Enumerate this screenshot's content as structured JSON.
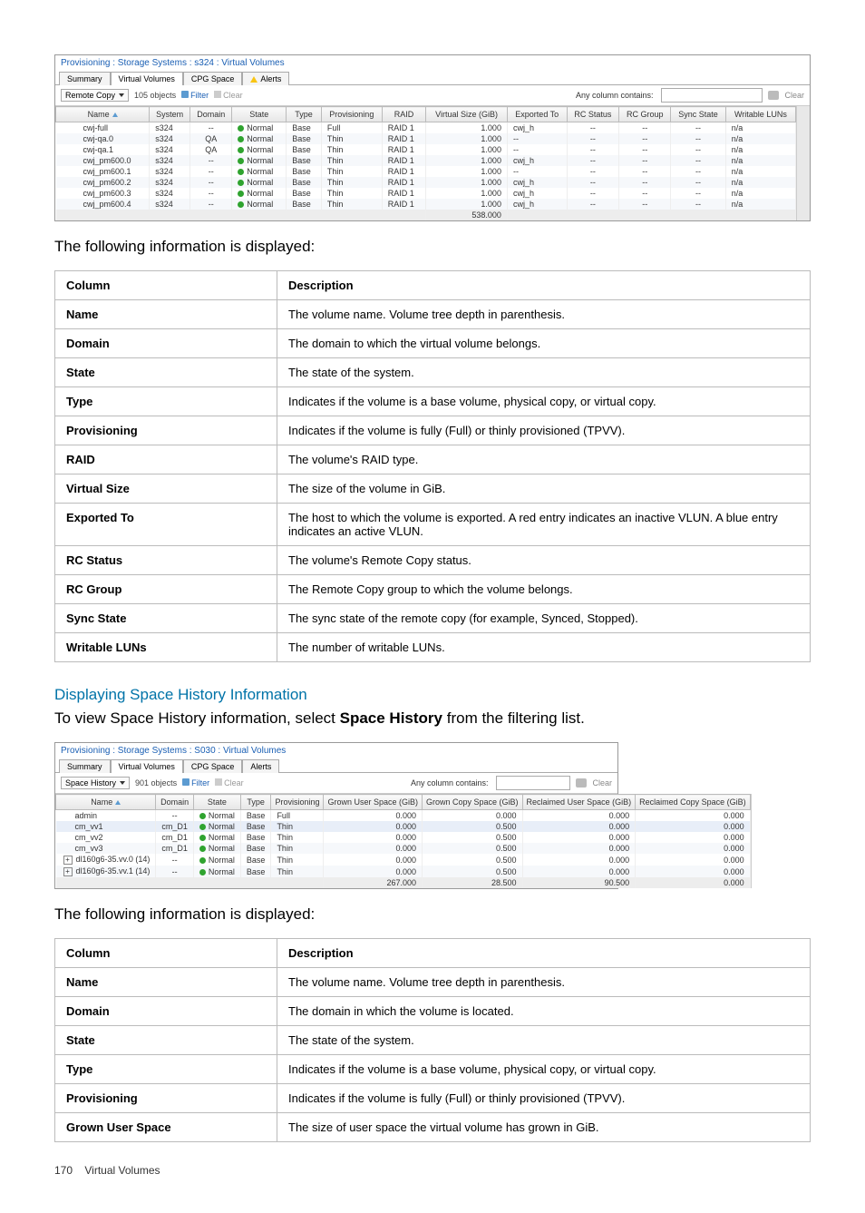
{
  "screenshot1": {
    "breadcrumb": "Provisioning : Storage Systems : s324 : Virtual Volumes",
    "tabs": [
      "Summary",
      "Virtual Volumes",
      "CPG Space",
      "Alerts"
    ],
    "activeTab": "Virtual Volumes",
    "selector": "Remote Copy",
    "objectCount": "105 objects",
    "filterLabel": "Filter",
    "clearLabel": "Clear",
    "anyColLabel": "Any column contains:",
    "clearBtn": "Clear",
    "columns": [
      "Name",
      "System",
      "Domain",
      "State",
      "Type",
      "Provisioning",
      "RAID",
      "Virtual Size (GiB)",
      "Exported To",
      "RC Status",
      "RC Group",
      "Sync State",
      "Writable LUNs"
    ],
    "rows": [
      {
        "name": "cwj-full",
        "system": "s324",
        "domain": "--",
        "state": "Normal",
        "type": "Base",
        "prov": "Full",
        "raid": "RAID 1",
        "vsize": "1.000",
        "exported": "cwj_h",
        "expcolor": "red",
        "rcst": "--",
        "rcg": "--",
        "sync": "--",
        "wl": "n/a"
      },
      {
        "name": "cwj-qa.0",
        "system": "s324",
        "domain": "QA",
        "state": "Normal",
        "type": "Base",
        "prov": "Thin",
        "raid": "RAID 1",
        "vsize": "1.000",
        "exported": "--",
        "expcolor": "",
        "rcst": "--",
        "rcg": "--",
        "sync": "--",
        "wl": "n/a"
      },
      {
        "name": "cwj-qa.1",
        "system": "s324",
        "domain": "QA",
        "state": "Normal",
        "type": "Base",
        "prov": "Thin",
        "raid": "RAID 1",
        "vsize": "1.000",
        "exported": "--",
        "expcolor": "",
        "rcst": "--",
        "rcg": "--",
        "sync": "--",
        "wl": "n/a"
      },
      {
        "name": "cwj_pm600.0",
        "system": "s324",
        "domain": "--",
        "state": "Normal",
        "type": "Base",
        "prov": "Thin",
        "raid": "RAID 1",
        "vsize": "1.000",
        "exported": "cwj_h",
        "expcolor": "red",
        "rcst": "--",
        "rcg": "--",
        "sync": "--",
        "wl": "n/a"
      },
      {
        "name": "cwj_pm600.1",
        "system": "s324",
        "domain": "--",
        "state": "Normal",
        "type": "Base",
        "prov": "Thin",
        "raid": "RAID 1",
        "vsize": "1.000",
        "exported": "--",
        "expcolor": "",
        "rcst": "--",
        "rcg": "--",
        "sync": "--",
        "wl": "n/a"
      },
      {
        "name": "cwj_pm600.2",
        "system": "s324",
        "domain": "--",
        "state": "Normal",
        "type": "Base",
        "prov": "Thin",
        "raid": "RAID 1",
        "vsize": "1.000",
        "exported": "cwj_h",
        "expcolor": "red",
        "rcst": "--",
        "rcg": "--",
        "sync": "--",
        "wl": "n/a"
      },
      {
        "name": "cwj_pm600.3",
        "system": "s324",
        "domain": "--",
        "state": "Normal",
        "type": "Base",
        "prov": "Thin",
        "raid": "RAID 1",
        "vsize": "1.000",
        "exported": "cwj_h",
        "expcolor": "red",
        "rcst": "--",
        "rcg": "--",
        "sync": "--",
        "wl": "n/a"
      },
      {
        "name": "cwj_pm600.4",
        "system": "s324",
        "domain": "--",
        "state": "Normal",
        "type": "Base",
        "prov": "Thin",
        "raid": "RAID 1",
        "vsize": "1.000",
        "exported": "cwj_h",
        "expcolor": "red",
        "rcst": "--",
        "rcg": "--",
        "sync": "--",
        "wl": "n/a"
      }
    ],
    "totalVsize": "538.000"
  },
  "para1": "The following information is displayed:",
  "table1": {
    "head": [
      "Column",
      "Description"
    ],
    "rows": [
      [
        "Name",
        "The volume name. Volume tree depth in parenthesis."
      ],
      [
        "Domain",
        "The domain to which the virtual volume belongs."
      ],
      [
        "State",
        "The state of the system."
      ],
      [
        "Type",
        "Indicates if the volume is a base volume, physical copy, or virtual copy."
      ],
      [
        "Provisioning",
        "Indicates if the volume is fully (Full) or thinly provisioned (TPVV)."
      ],
      [
        "RAID",
        "The volume's RAID type."
      ],
      [
        "Virtual Size",
        "The size of the volume in GiB."
      ],
      [
        "Exported To",
        "The host to which the volume is exported. A red entry indicates an inactive VLUN. A blue entry indicates an active VLUN."
      ],
      [
        "RC Status",
        "The volume's Remote Copy status."
      ],
      [
        "RC Group",
        "The Remote Copy group to which the volume belongs."
      ],
      [
        "Sync State",
        "The sync state of the remote copy (for example, Synced, Stopped)."
      ],
      [
        "Writable LUNs",
        "The number of writable LUNs."
      ]
    ]
  },
  "sectionTitle": "Displaying Space History Information",
  "para2a": "To view Space History information, select ",
  "para2b": "Space History",
  "para2c": " from the filtering list.",
  "screenshot2": {
    "breadcrumb": "Provisioning : Storage Systems : S030 : Virtual Volumes",
    "tabs": [
      "Summary",
      "Virtual Volumes",
      "CPG Space",
      "Alerts"
    ],
    "activeTab": "Virtual Volumes",
    "selector": "Space History",
    "objectCount": "901 objects",
    "filterLabel": "Filter",
    "clearLabel": "Clear",
    "anyColLabel": "Any column contains:",
    "clearBtn": "Clear",
    "columns": [
      "Name",
      "Domain",
      "State",
      "Type",
      "Provisioning",
      "Grown User Space (GiB)",
      "Grown Copy Space (GiB)",
      "Reclaimed User Space (GiB)",
      "Reclaimed Copy Space (GiB)"
    ],
    "rows": [
      {
        "name": "admin",
        "domain": "--",
        "state": "Normal",
        "type": "Base",
        "prov": "Full",
        "gus": "0.000",
        "gcs": "0.000",
        "rus": "0.000",
        "rcs": "0.000",
        "hl": false,
        "blue": false
      },
      {
        "name": "cm_vv1",
        "domain": "cm_D1",
        "state": "Normal",
        "type": "Base",
        "prov": "Thin",
        "gus": "0.000",
        "gcs": "0.500",
        "rus": "0.000",
        "rcs": "0.000",
        "hl": true,
        "blue": true
      },
      {
        "name": "cm_vv2",
        "domain": "cm_D1",
        "state": "Normal",
        "type": "Base",
        "prov": "Thin",
        "gus": "0.000",
        "gcs": "0.500",
        "rus": "0.000",
        "rcs": "0.000",
        "hl": false,
        "blue": true
      },
      {
        "name": "cm_vv3",
        "domain": "cm_D1",
        "state": "Normal",
        "type": "Base",
        "prov": "Thin",
        "gus": "0.000",
        "gcs": "0.500",
        "rus": "0.000",
        "rcs": "0.000",
        "hl": false,
        "blue": true
      },
      {
        "name": "dl160g6-35.vv.0   (14)",
        "domain": "--",
        "state": "Normal",
        "type": "Base",
        "prov": "Thin",
        "gus": "0.000",
        "gcs": "0.500",
        "rus": "0.000",
        "rcs": "0.000",
        "hl": false,
        "blue": true,
        "expand": true
      },
      {
        "name": "dl160g6-35.vv.1   (14)",
        "domain": "--",
        "state": "Normal",
        "type": "Base",
        "prov": "Thin",
        "gus": "0.000",
        "gcs": "0.500",
        "rus": "0.000",
        "rcs": "0.000",
        "hl": false,
        "blue": true,
        "expand": true
      }
    ],
    "totals": {
      "gus": "267.000",
      "gcs": "28.500",
      "rus": "90.500",
      "rcs": "0.000"
    }
  },
  "para3": "The following information is displayed:",
  "table2": {
    "head": [
      "Column",
      "Description"
    ],
    "rows": [
      [
        "Name",
        "The volume name. Volume tree depth in parenthesis."
      ],
      [
        "Domain",
        "The domain in which the volume is located."
      ],
      [
        "State",
        "The state of the system."
      ],
      [
        "Type",
        "Indicates if the volume is a base volume, physical copy, or virtual copy."
      ],
      [
        "Provisioning",
        "Indicates if the volume is fully (Full) or thinly provisioned (TPVV)."
      ],
      [
        "Grown User Space",
        "The size of user space the virtual volume has grown in GiB."
      ]
    ]
  },
  "footer": {
    "page": "170",
    "title": "Virtual Volumes"
  }
}
